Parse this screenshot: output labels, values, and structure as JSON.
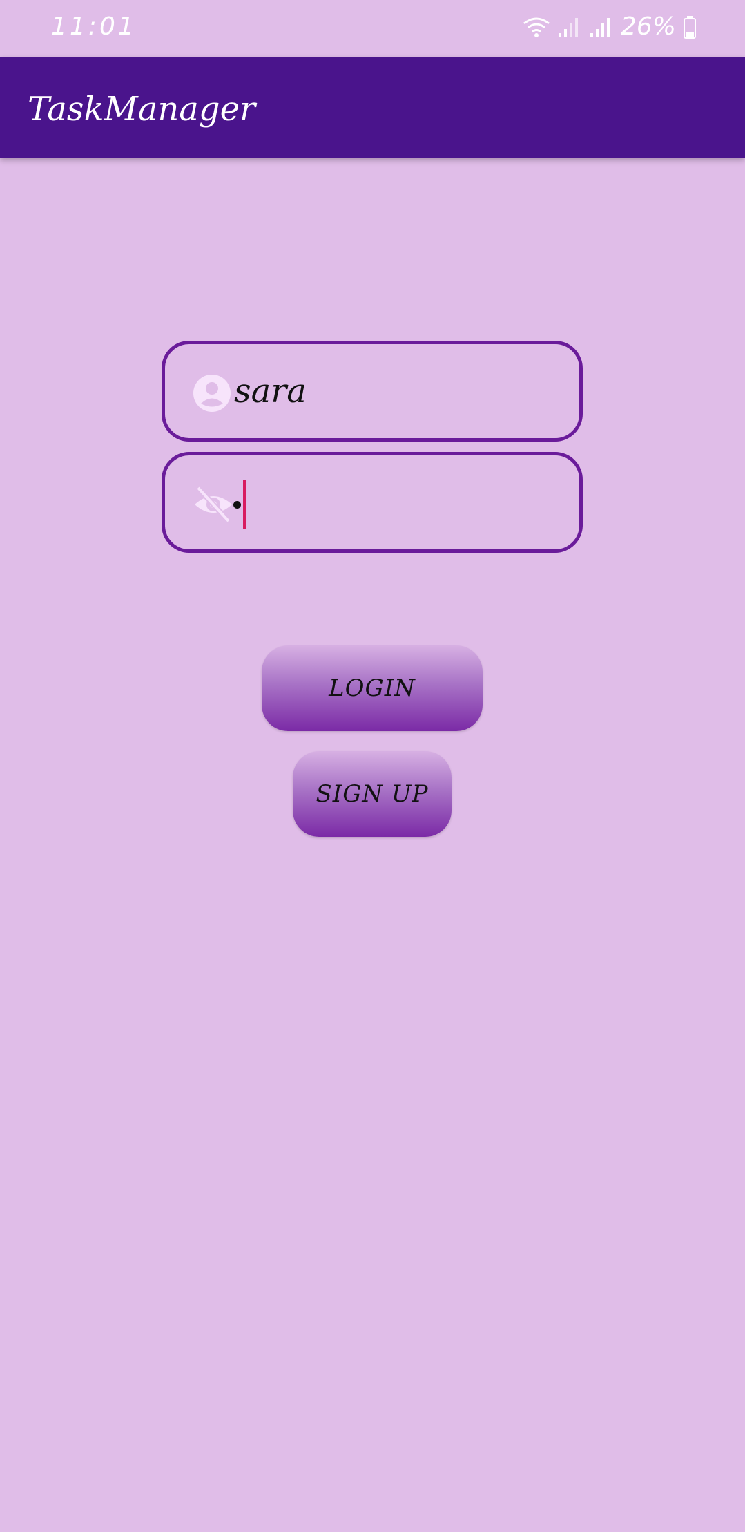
{
  "status_bar": {
    "time": "11:01",
    "battery": "26%",
    "icons": [
      "wifi-icon",
      "signal-icon",
      "signal-icon",
      "battery-icon"
    ]
  },
  "app_bar": {
    "title": "TaskManager",
    "background_color": "#4a148c"
  },
  "login_form": {
    "username": {
      "value": "sara",
      "icon": "person-icon"
    },
    "password": {
      "value": "•",
      "icon": "eye-off-icon"
    },
    "login_button_label": "LOGIN",
    "signup_button_label": "SIGN UP"
  },
  "colors": {
    "background": "#e0bde8",
    "accent": "#6a1b9a",
    "cursor": "#d81b60"
  }
}
